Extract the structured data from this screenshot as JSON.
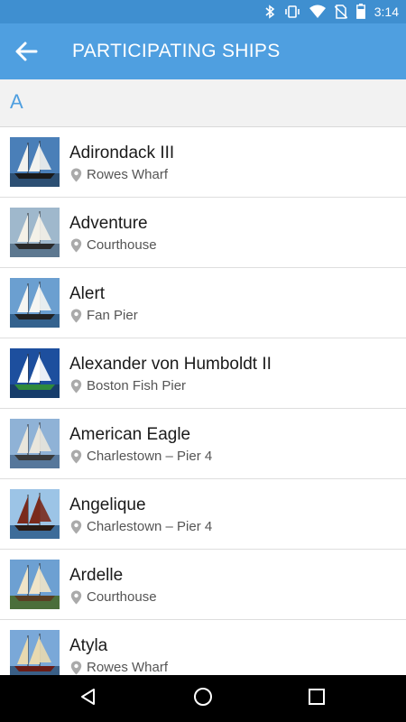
{
  "status_bar": {
    "time": "3:14",
    "icons": [
      "bluetooth-icon",
      "vibrate-icon",
      "wifi-icon",
      "no-sim-icon",
      "battery-icon"
    ]
  },
  "app_bar": {
    "title": "PARTICIPATING SHIPS",
    "back_icon": "arrow-left-icon"
  },
  "section": {
    "letter": "A"
  },
  "ships": [
    {
      "name": "Adirondack III",
      "location": "Rowes Wharf",
      "thumb": {
        "sky": "#4a7fb8",
        "sea": "#2c4f73",
        "hull": "#1a1a1a",
        "sail": "#f2f2ee"
      }
    },
    {
      "name": "Adventure",
      "location": "Courthouse",
      "thumb": {
        "sky": "#9fb8cc",
        "sea": "#5d7890",
        "hull": "#2a2a2a",
        "sail": "#f4f1e8"
      }
    },
    {
      "name": "Alert",
      "location": "Fan Pier",
      "thumb": {
        "sky": "#6b9fd0",
        "sea": "#34628e",
        "hull": "#222222",
        "sail": "#f5f5f2"
      }
    },
    {
      "name": "Alexander von Humboldt II",
      "location": "Boston Fish Pier",
      "thumb": {
        "sky": "#1d4f9e",
        "sea": "#173d6b",
        "hull": "#2f8a3c",
        "sail": "#ffffff"
      }
    },
    {
      "name": "American Eagle",
      "location": "Charlestown – Pier 4",
      "thumb": {
        "sky": "#8fb2d6",
        "sea": "#56779b",
        "hull": "#3a3a3a",
        "sail": "#e9e6dc"
      }
    },
    {
      "name": "Angelique",
      "location": "Charlestown – Pier 4",
      "thumb": {
        "sky": "#9cc4e6",
        "sea": "#3d6c99",
        "hull": "#2a1b14",
        "sail": "#7a2a1c"
      }
    },
    {
      "name": "Ardelle",
      "location": "Courthouse",
      "thumb": {
        "sky": "#6da0d2",
        "sea": "#4b6e3a",
        "hull": "#5a3e22",
        "sail": "#efe4c8"
      }
    },
    {
      "name": "Atyla",
      "location": "Rowes Wharf",
      "thumb": {
        "sky": "#7aa8d8",
        "sea": "#3a5f86",
        "hull": "#6a1c16",
        "sail": "#e8d9b0"
      }
    }
  ],
  "nav_bar": {
    "icons": [
      "back-triangle-icon",
      "home-circle-icon",
      "recents-square-icon"
    ]
  }
}
